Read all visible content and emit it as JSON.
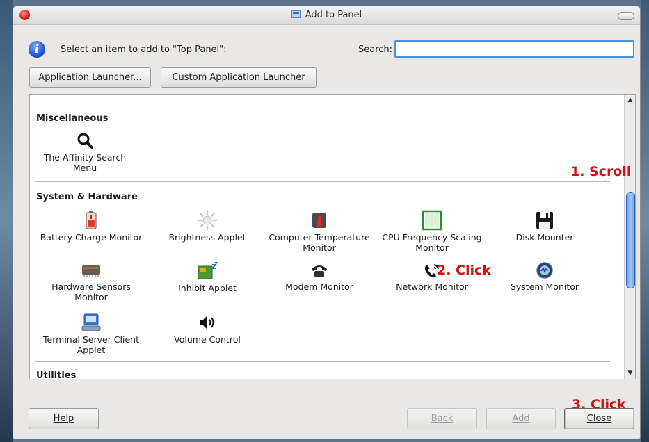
{
  "window": {
    "title": "Add to Panel"
  },
  "header": {
    "prompt": "Select an item to add to \"Top Panel\":",
    "search_label": "Search:",
    "search_value": ""
  },
  "launcher_buttons": {
    "application_launcher": "Application Launcher...",
    "custom_application_launcher": "Custom Application Launcher"
  },
  "categories": [
    {
      "name": "Miscellaneous",
      "items": [
        {
          "label": "The Affinity Search Menu",
          "icon": "magnifier-icon"
        }
      ]
    },
    {
      "name": "System & Hardware",
      "items": [
        {
          "label": "Battery Charge Monitor",
          "icon": "battery-icon"
        },
        {
          "label": "Brightness Applet",
          "icon": "brightness-icon"
        },
        {
          "label": "Computer Temperature Monitor",
          "icon": "thermometer-icon"
        },
        {
          "label": "CPU Frequency Scaling Monitor",
          "icon": "cpu-frequency-icon"
        },
        {
          "label": "Disk Mounter",
          "icon": "floppy-disk-icon"
        },
        {
          "label": "Hardware Sensors Monitor",
          "icon": "chip-icon"
        },
        {
          "label": "Inhibit Applet",
          "icon": "inhibit-icon"
        },
        {
          "label": "Modem Monitor",
          "icon": "modem-icon"
        },
        {
          "label": "Network Monitor",
          "icon": "phone-network-icon"
        },
        {
          "label": "System Monitor",
          "icon": "system-monitor-icon"
        },
        {
          "label": "Terminal Server Client Applet",
          "icon": "terminal-server-icon"
        },
        {
          "label": "Volume Control",
          "icon": "speaker-icon"
        }
      ]
    },
    {
      "name": "Utilities",
      "items": []
    }
  ],
  "annotations": {
    "scroll": "1. Scroll",
    "click_network": "2. Click",
    "click_close": "3. Click"
  },
  "footer": {
    "help": "Help",
    "back": "Back",
    "add": "Add",
    "close": "Close"
  },
  "colors": {
    "annotation": "#d40f0f",
    "scroll_thumb": "#6e9df0",
    "search_focus": "#4a90d9"
  }
}
